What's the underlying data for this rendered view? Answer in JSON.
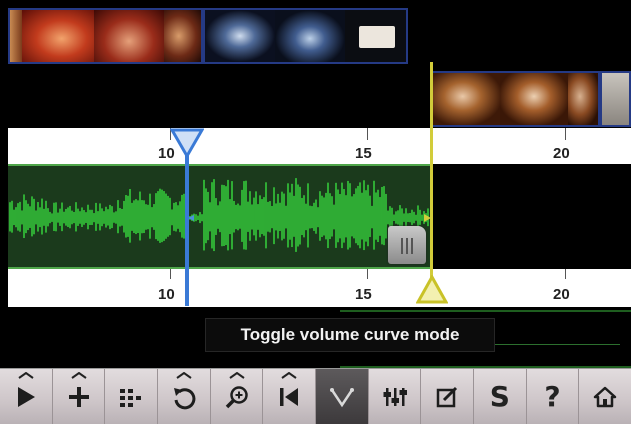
{
  "ruler": {
    "top_ticks": [
      "10",
      "15",
      "20"
    ],
    "bottom_ticks": [
      "10",
      "15",
      "20"
    ]
  },
  "tooltip": {
    "text": "Toggle volume curve mode"
  },
  "toolbar": {
    "buttons": [
      {
        "name": "play",
        "icon": "play-icon",
        "has_menu": true
      },
      {
        "name": "add",
        "icon": "plus-icon",
        "has_menu": true
      },
      {
        "name": "grid",
        "icon": "grid-icon",
        "has_menu": false
      },
      {
        "name": "undo",
        "icon": "undo-icon",
        "has_menu": true
      },
      {
        "name": "zoom",
        "icon": "zoom-icon",
        "has_menu": true
      },
      {
        "name": "jump-to-start",
        "icon": "skip-back-icon",
        "has_menu": true
      },
      {
        "name": "volume-curve",
        "icon": "volume-curve-icon",
        "has_menu": false,
        "active": true
      },
      {
        "name": "mixer",
        "icon": "mixer-icon",
        "has_menu": false
      },
      {
        "name": "edit",
        "icon": "edit-icon",
        "has_menu": false
      },
      {
        "name": "share",
        "icon": "s-icon",
        "has_menu": false
      },
      {
        "name": "help",
        "icon": "help-icon",
        "has_menu": false
      },
      {
        "name": "home",
        "icon": "home-icon",
        "has_menu": false
      }
    ],
    "labels": {
      "share": "S",
      "help": "?"
    }
  },
  "colors": {
    "audio_wave": "#35c83a",
    "audio_bg": "#1b3a1c",
    "playhead_blue": "#3a7ad6",
    "playhead_yellow": "#d2cc3a",
    "clip_border": "#253a85",
    "toolbar_bg": "#d6cfd2"
  }
}
